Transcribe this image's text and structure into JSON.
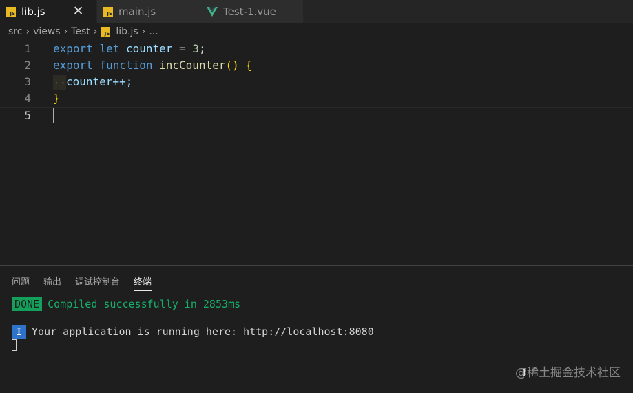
{
  "tabs": [
    {
      "label": "lib.js",
      "icon": "js-icon",
      "active": true,
      "close": "✕"
    },
    {
      "label": "main.js",
      "icon": "js-icon",
      "active": false
    },
    {
      "label": "Test-1.vue",
      "icon": "vue-icon",
      "active": false
    }
  ],
  "icons": {
    "js_text": "JS"
  },
  "breadcrumb": {
    "items": [
      "src",
      "views",
      "Test",
      "lib.js",
      "..."
    ],
    "separator": "›"
  },
  "editor": {
    "line_numbers": [
      "1",
      "2",
      "3",
      "4",
      "5"
    ],
    "current_line": 5,
    "lines": [
      {
        "export": "export",
        "let": "let",
        "name": "counter",
        "eq": "=",
        "value": "3",
        "semi": ";"
      },
      {
        "export": "export",
        "function": "function",
        "name": "incCounter",
        "parens": "()",
        "brace": "{"
      },
      {
        "indent": "··",
        "stmt": "counter++;"
      },
      {
        "brace": "}"
      }
    ]
  },
  "panel": {
    "tabs": [
      "问题",
      "输出",
      "调试控制台",
      "终端"
    ],
    "active_tab": "终端",
    "terminal": {
      "done_badge": "DONE",
      "done_text": "Compiled successfully in 2853ms",
      "info_badge": "I",
      "info_text": "Your application is running here: http://localhost:8080"
    }
  },
  "watermark": "@稀土掘金技术社区",
  "colors": {
    "keyword": "#569cd6",
    "variable": "#9cdcfe",
    "function": "#dcdcaa",
    "number": "#b5cea8",
    "brace": "#ffd700",
    "success": "#17b06b",
    "info": "#2e73c9",
    "js_icon": "#e8b923",
    "vue_icon": "#41b883"
  }
}
